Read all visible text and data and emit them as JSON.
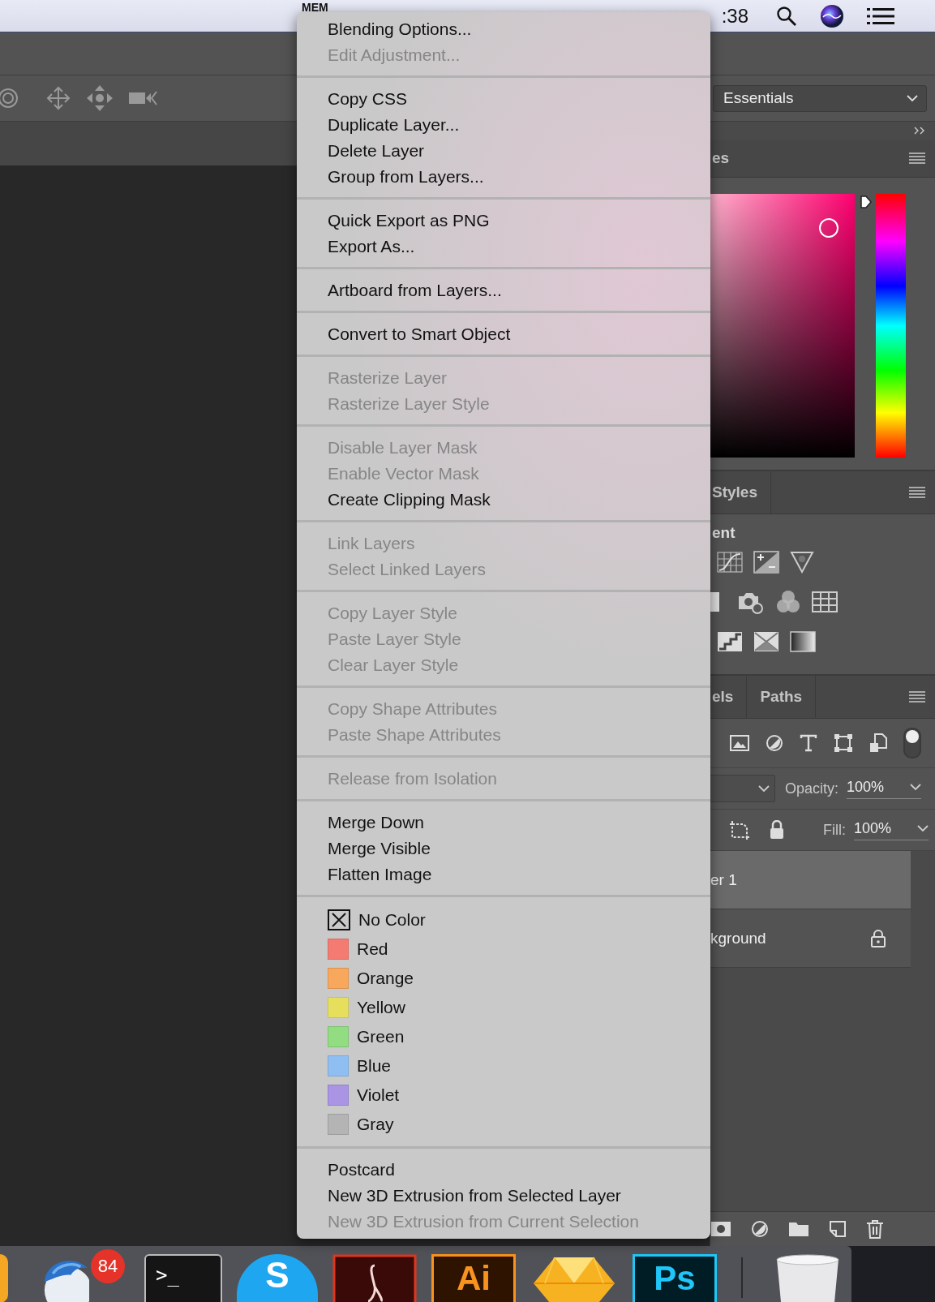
{
  "menu_bar": {
    "status_text": "MEM",
    "clock": ":38"
  },
  "options_bar": {
    "workspace": "Essentials"
  },
  "panels": {
    "hue": {
      "level": 0.97
    },
    "color_tab": "es",
    "styles_tab": "Styles",
    "adjustments_label": "ent",
    "layers_tabs": [
      "els",
      "Paths"
    ],
    "opacity_label": "Opacity:",
    "opacity": "100%",
    "fill_label": "Fill:",
    "fill": "100%",
    "layers": [
      {
        "name": "er 1",
        "selected": true,
        "locked": false
      },
      {
        "name": "kground",
        "selected": false,
        "locked": true
      }
    ]
  },
  "context_menu": {
    "sections": [
      {
        "items": [
          {
            "kind": "text",
            "label": "Blending Options...",
            "disabled": false
          },
          {
            "kind": "text",
            "label": "Edit Adjustment...",
            "disabled": true
          }
        ]
      },
      {
        "items": [
          {
            "kind": "text",
            "label": "Copy CSS",
            "disabled": false
          },
          {
            "kind": "text",
            "label": "Duplicate Layer...",
            "disabled": false
          },
          {
            "kind": "text",
            "label": "Delete Layer",
            "disabled": false
          },
          {
            "kind": "text",
            "label": "Group from Layers...",
            "disabled": false
          }
        ]
      },
      {
        "items": [
          {
            "kind": "text",
            "label": "Quick Export as PNG",
            "disabled": false
          },
          {
            "kind": "text",
            "label": "Export As...",
            "disabled": false
          }
        ]
      },
      {
        "items": [
          {
            "kind": "text",
            "label": "Artboard from Layers...",
            "disabled": false
          }
        ]
      },
      {
        "items": [
          {
            "kind": "text",
            "label": "Convert to Smart Object",
            "disabled": false
          }
        ]
      },
      {
        "items": [
          {
            "kind": "text",
            "label": "Rasterize Layer",
            "disabled": true
          },
          {
            "kind": "text",
            "label": "Rasterize Layer Style",
            "disabled": true
          }
        ]
      },
      {
        "items": [
          {
            "kind": "text",
            "label": "Disable Layer Mask",
            "disabled": true
          },
          {
            "kind": "text",
            "label": "Enable Vector Mask",
            "disabled": true
          },
          {
            "kind": "text",
            "label": "Create Clipping Mask",
            "disabled": false
          }
        ]
      },
      {
        "items": [
          {
            "kind": "text",
            "label": "Link Layers",
            "disabled": true
          },
          {
            "kind": "text",
            "label": "Select Linked Layers",
            "disabled": true
          }
        ]
      },
      {
        "items": [
          {
            "kind": "text",
            "label": "Copy Layer Style",
            "disabled": true
          },
          {
            "kind": "text",
            "label": "Paste Layer Style",
            "disabled": true
          },
          {
            "kind": "text",
            "label": "Clear Layer Style",
            "disabled": true
          }
        ]
      },
      {
        "items": [
          {
            "kind": "text",
            "label": "Copy Shape Attributes",
            "disabled": true
          },
          {
            "kind": "text",
            "label": "Paste Shape Attributes",
            "disabled": true
          }
        ]
      },
      {
        "items": [
          {
            "kind": "text",
            "label": "Release from Isolation",
            "disabled": true
          }
        ]
      },
      {
        "items": [
          {
            "kind": "text",
            "label": "Merge Down",
            "disabled": false
          },
          {
            "kind": "text",
            "label": "Merge Visible",
            "disabled": false
          },
          {
            "kind": "text",
            "label": "Flatten Image",
            "disabled": false
          }
        ]
      },
      {
        "items": [
          {
            "kind": "none",
            "label": "No Color"
          },
          {
            "kind": "color",
            "label": "Red",
            "color": "#f47b72"
          },
          {
            "kind": "color",
            "label": "Orange",
            "color": "#f7a85c"
          },
          {
            "kind": "color",
            "label": "Yellow",
            "color": "#e6df5e"
          },
          {
            "kind": "color",
            "label": "Green",
            "color": "#92dc82"
          },
          {
            "kind": "color",
            "label": "Blue",
            "color": "#8fbff2"
          },
          {
            "kind": "color",
            "label": "Violet",
            "color": "#a995e4"
          },
          {
            "kind": "color",
            "label": "Gray",
            "color": "#b4b4b4"
          }
        ]
      },
      {
        "items": [
          {
            "kind": "text",
            "label": "Postcard",
            "disabled": false
          },
          {
            "kind": "text",
            "label": "New 3D Extrusion from Selected Layer",
            "disabled": false
          },
          {
            "kind": "text",
            "label": "New 3D Extrusion from Current Selection",
            "disabled": true
          }
        ]
      }
    ]
  },
  "dock": [
    {
      "kind": "bird",
      "badge": "84"
    },
    {
      "kind": "terminal",
      "label": ">_"
    },
    {
      "kind": "skype",
      "label": "S"
    },
    {
      "kind": "acrobat"
    },
    {
      "kind": "illustrator",
      "label": "Ai"
    },
    {
      "kind": "sketch"
    },
    {
      "kind": "photoshop",
      "label": "Ps"
    },
    {
      "kind": "trash"
    }
  ]
}
